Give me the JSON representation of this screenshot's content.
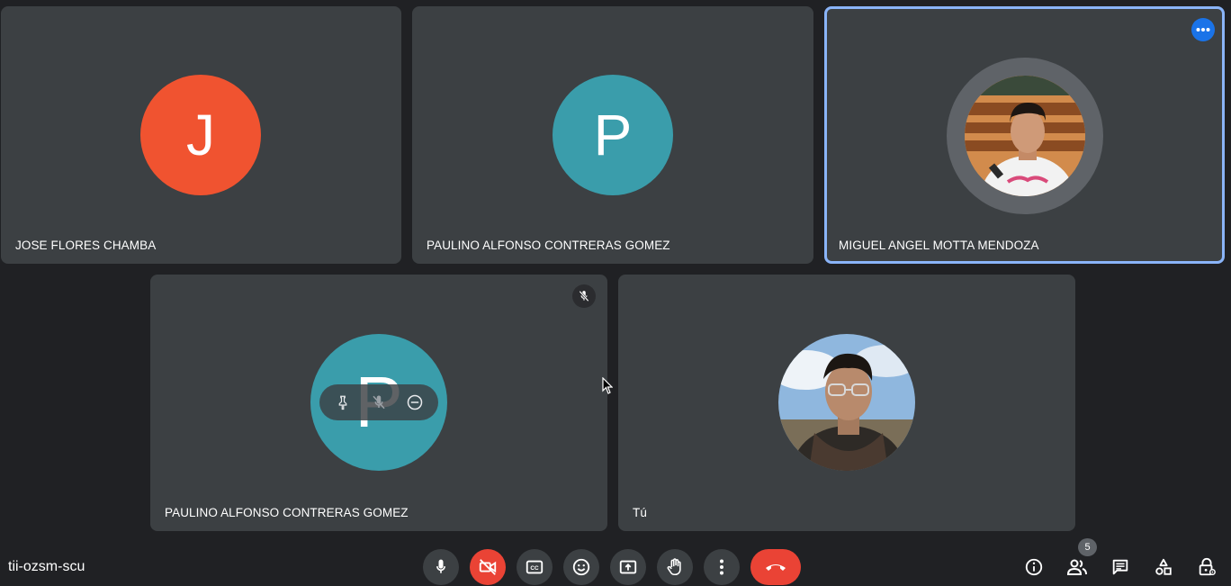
{
  "meeting": {
    "code": "tii-ozsm-scu"
  },
  "tiles": {
    "t1": {
      "name": "JOSE FLORES CHAMBA",
      "initial": "J",
      "avatar_color": "#f05330"
    },
    "t2": {
      "name": "PAULINO ALFONSO CONTRERAS GOMEZ",
      "initial": "P",
      "avatar_color": "#3a9dab"
    },
    "t3": {
      "name": "MIGUEL ANGEL MOTTA MENDOZA",
      "avatar": "photo",
      "active_speaker": true,
      "more_button_icon": "more-horiz-icon"
    },
    "t4": {
      "name": "PAULINO ALFONSO CONTRERAS GOMEZ",
      "initial": "P",
      "avatar_color": "#3a9dab",
      "muted": true,
      "hover_actions": [
        "pin-icon",
        "mute-icon",
        "remove-icon"
      ]
    },
    "t5": {
      "name": "Tú",
      "avatar": "photo"
    }
  },
  "controls": {
    "items": [
      "mic-icon",
      "camera-off-icon",
      "captions-icon",
      "emoji-icon",
      "present-icon",
      "raise-hand-icon",
      "more-vert-icon",
      "hangup-icon"
    ]
  },
  "side_panel": {
    "items": [
      "info-icon",
      "people-icon",
      "chat-icon",
      "activities-icon",
      "host-controls-icon"
    ],
    "participants_count": "5"
  },
  "colors": {
    "background": "#202124",
    "tile": "#3c4043",
    "accent": "#8ab4f8",
    "red": "#ea4335"
  }
}
